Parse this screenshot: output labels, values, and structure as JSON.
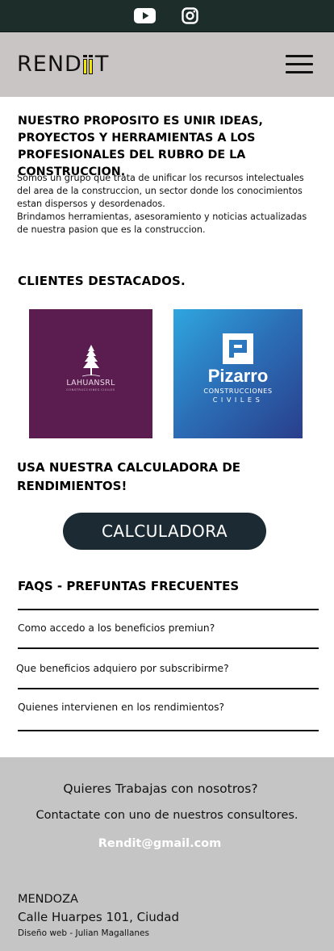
{
  "topbar": {
    "icons": [
      "youtube-icon",
      "instagram-icon"
    ],
    "background": "#1c2d2a"
  },
  "header": {
    "logo_text_left": "REND",
    "logo_text_right": "T",
    "logo_accent": "#f2e600",
    "menu_icon": "hamburger-menu-icon",
    "background": "#c9c5c5"
  },
  "intro": {
    "title": "NUESTRO PROPOSITO ES UNIR IDEAS, PROYECTOS Y HERRAMIENTAS A LOS PROFESIONALES DEL RUBRO DE LA CONSTRUCCION.",
    "paragraph1": "Somos un grupo que trata de unificar los recursos intelectuales del area de la construccion, un sector donde los conocimientos estan dispersos y desordenados.",
    "paragraph2": "Brindamos herramientas, asesoramiento y noticias actualizadas de nuestra pasion que es la construccion."
  },
  "clients": {
    "title": "CLIENTES DESTACADOS.",
    "items": [
      {
        "name": "LAHUANSRL",
        "subtitle": "CONSTRUCCIONES CIVILES",
        "color": "#5b1c4f"
      },
      {
        "name": "Pizarro",
        "subtitle1": "CONSTRUCCIONES",
        "subtitle2": "CIVILES",
        "color": "#2b6cb5"
      }
    ]
  },
  "calculator": {
    "title": "USA NUESTRA CALCULADORA DE RENDIMIENTOS!",
    "button_label": "CALCULADORA",
    "button_color": "#1c2b33"
  },
  "faq": {
    "title": "FAQS - PREFUNTAS FRECUENTES",
    "items": [
      "Como accedo a los beneficios premiun?",
      "Que beneficios adquiero por subscribirme?",
      "Quienes intervienen en los rendimientos?"
    ]
  },
  "footer": {
    "line1": "Quieres Trabajas con nosotros?",
    "line2": "Contactate con uno de nuestros consultores.",
    "email": "Rendit@gmail.com",
    "city": "MENDOZA",
    "address": "Calle Huarpes 101, Ciudad",
    "credit": "Diseño web - Julian Magallanes",
    "background": "#c5c5c5"
  }
}
